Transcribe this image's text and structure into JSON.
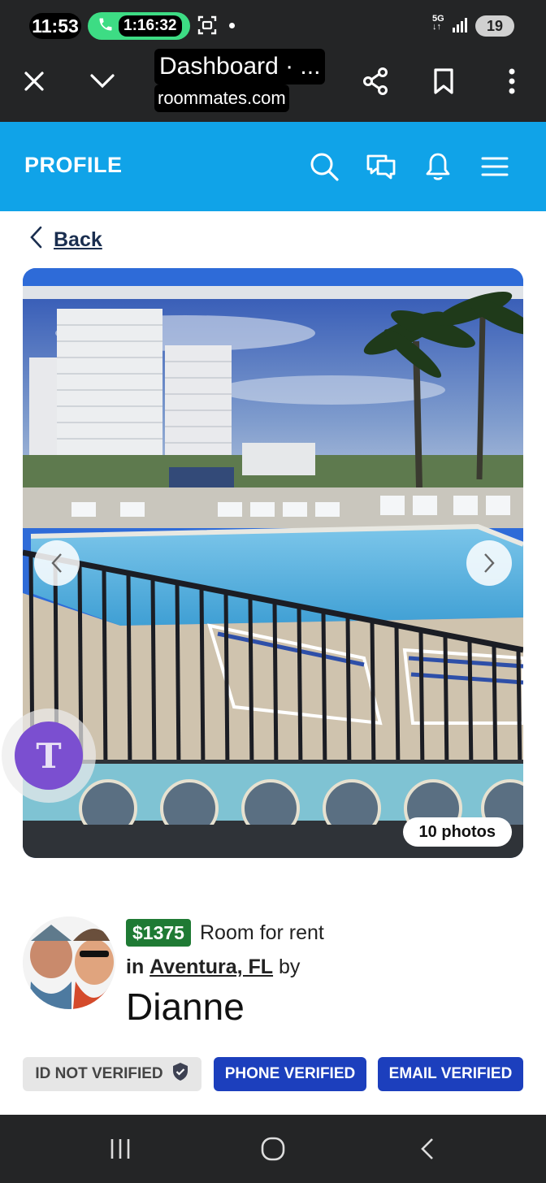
{
  "status_bar": {
    "time": "11:53",
    "call_timer": "1:16:32",
    "network": "5G",
    "battery": "19"
  },
  "browser": {
    "title": "Dashboard · ...",
    "url": "roommates.com"
  },
  "app_header": {
    "title": "PROFILE"
  },
  "back_link": "Back",
  "gallery": {
    "photo_count": "10 photos",
    "floating_badge_letter": "T"
  },
  "listing": {
    "price": "$1375",
    "type": "Room for rent",
    "in_label": "in",
    "location": "Aventura, FL",
    "by_label": "by",
    "owner": "Dianne"
  },
  "verification": {
    "id": "ID NOT VERIFIED",
    "phone": "PHONE VERIFIED",
    "email": "EMAIL VERIFIED"
  },
  "colors": {
    "app_bar": "#10a3e8",
    "price_badge": "#1f7a34",
    "verified_badge": "#1c3fbd"
  }
}
